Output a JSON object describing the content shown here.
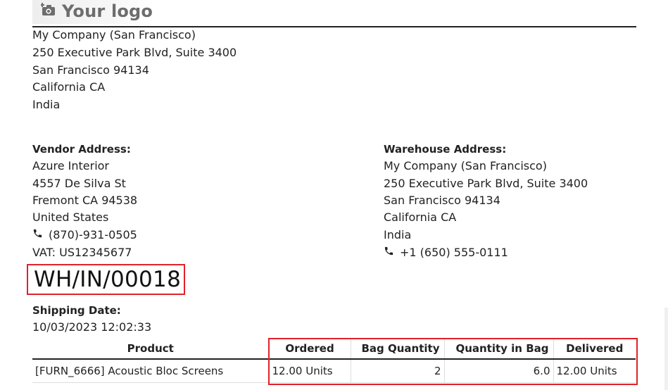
{
  "logo": {
    "text": "Your logo",
    "icon": "camera-plus-icon",
    "icon_color": "#6d6d6d"
  },
  "company_address": [
    "My Company (San Francisco)",
    "250 Executive Park Blvd, Suite 3400",
    "San Francisco 94134",
    "California CA",
    "India"
  ],
  "vendor": {
    "label": "Vendor Address:",
    "lines": [
      "Azure Interior",
      "4557 De Silva St",
      "Fremont CA 94538",
      "United States"
    ],
    "phone": "(870)-931-0505",
    "vat": "VAT: US12345677"
  },
  "warehouse": {
    "label": "Warehouse Address:",
    "lines": [
      "My Company (San Francisco)",
      "250 Executive Park Blvd, Suite 3400",
      "San Francisco 94134",
      "California CA",
      "India"
    ],
    "phone": "+1 (650) 555-0111"
  },
  "reference": "WH/IN/00018",
  "shipping": {
    "label": "Shipping Date:",
    "date": "10/03/2023 12:02:33"
  },
  "table": {
    "headers": [
      "Product",
      "Ordered",
      "Bag Quantity",
      "Quantity in Bag",
      "Delivered"
    ],
    "rows": [
      [
        "[FURN_6666] Acoustic Bloc Screens",
        "12.00 Units",
        "2",
        "6.0",
        "12.00 Units"
      ]
    ]
  },
  "colors": {
    "highlight": "#e0222a",
    "text": "#222222"
  }
}
